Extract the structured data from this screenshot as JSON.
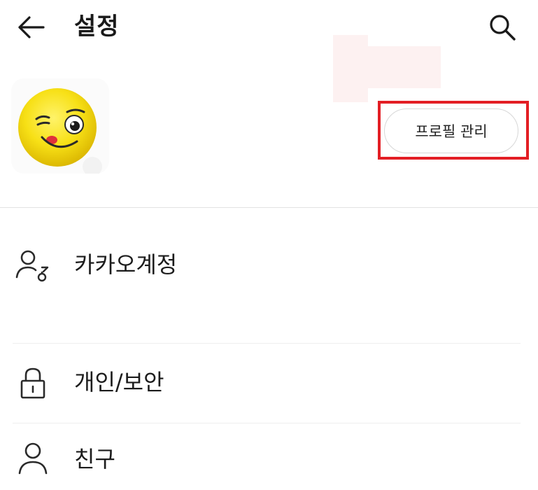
{
  "header": {
    "title": "설정",
    "back_icon": "arrow-left-icon",
    "search_icon": "search-icon"
  },
  "profile": {
    "avatar_icon": "emoji-wink-avatar",
    "manage_button_label": "프로필 관리",
    "highlight_color": "#e31e24"
  },
  "menu": {
    "items": [
      {
        "label": "카카오계정",
        "icon": "account-key-icon"
      },
      {
        "label": "개인/보안",
        "icon": "lock-icon"
      },
      {
        "label": "친구",
        "icon": "person-icon"
      }
    ]
  }
}
